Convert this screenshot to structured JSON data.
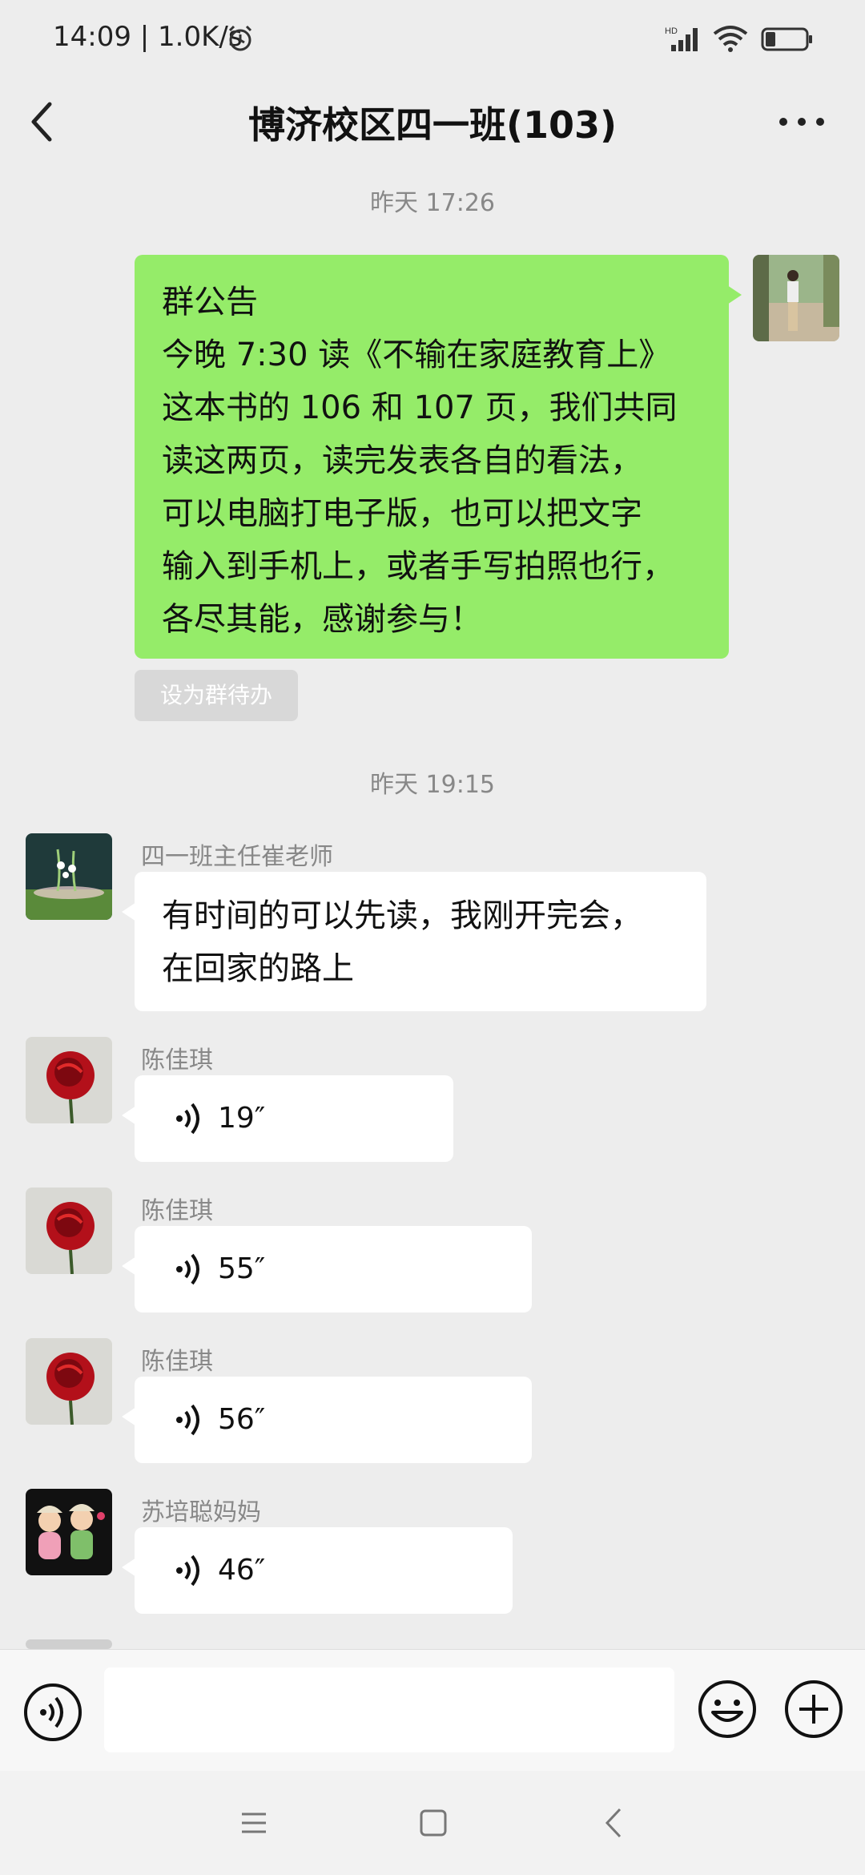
{
  "status": {
    "time": "14:09 | 1.0K/s",
    "network": "HD"
  },
  "nav": {
    "title": "博济校区四一班(103)"
  },
  "timestamps": [
    "昨天 17:26",
    "昨天 19:15"
  ],
  "notice": {
    "label": "群公告",
    "text": "今晚 7:30 读《不输在家庭教育上》\n这本书的 106 和 107 页，我们共同\n读这两页，读完发表各自的看法，\n可以电脑打电子版，也可以把文字\n输入到手机上，或者手写拍照也行，\n各尽其能，感谢参与！",
    "todo_label": "设为群待办"
  },
  "messages": [
    {
      "sender": "四一班主任崔老师",
      "text": "有时间的可以先读，我刚开完会，\n在回家的路上"
    },
    {
      "sender": "陈佳琪",
      "duration": "19″"
    },
    {
      "sender": "陈佳琪",
      "duration": "55″"
    },
    {
      "sender": "陈佳琪",
      "duration": "56″"
    },
    {
      "sender": "苏培聪妈妈",
      "duration": "46″"
    }
  ],
  "input": {
    "placeholder": ""
  },
  "colors": {
    "my_bubble": "#95ec69",
    "their_bubble": "#ffffff",
    "background": "#ededed"
  }
}
